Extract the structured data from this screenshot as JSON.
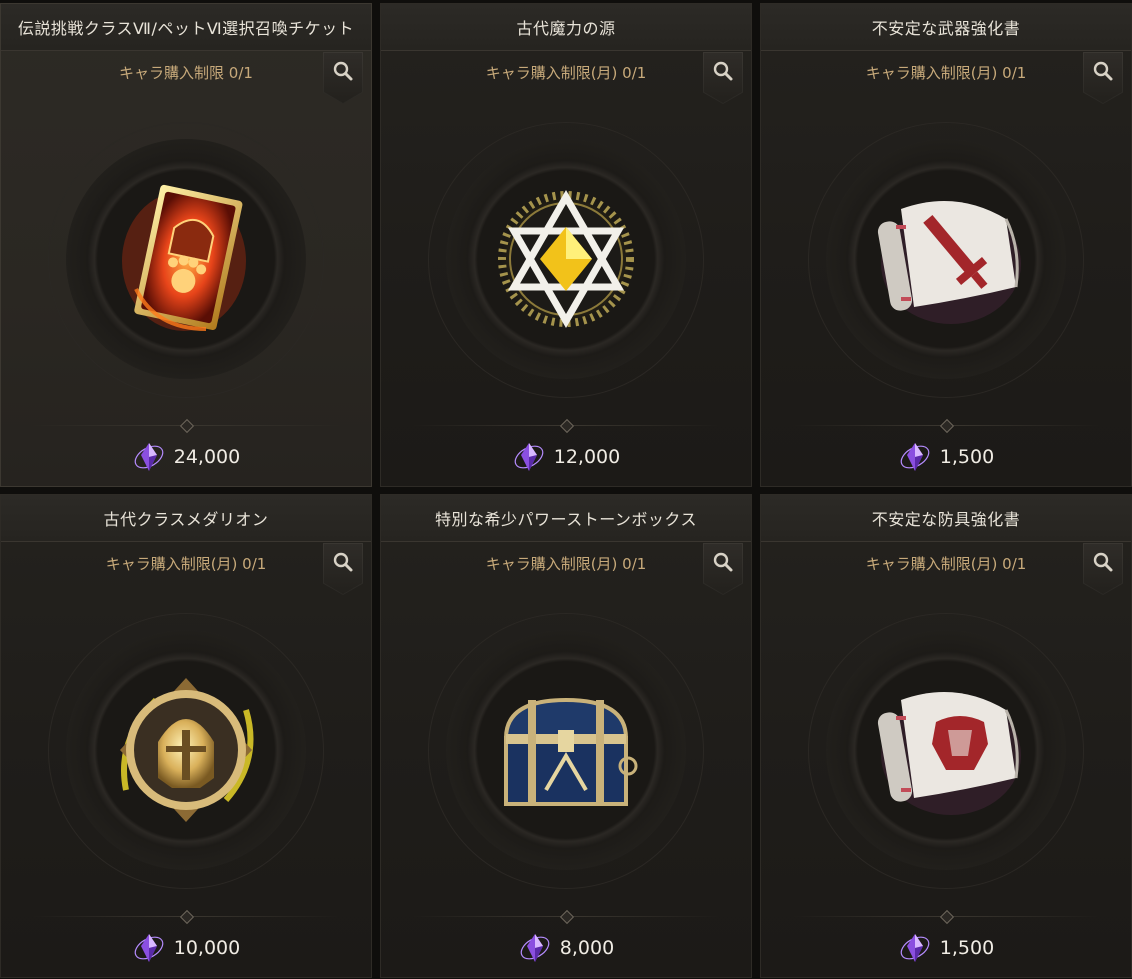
{
  "items": [
    {
      "title": "伝説挑戦クラスⅦ/ペットⅥ選択召喚チケット",
      "limit": "キャラ購入制限 0/1",
      "price": "24,000",
      "icon": "legendary-ticket-icon"
    },
    {
      "title": "古代魔力の源",
      "limit": "キャラ購入制限(月) 0/1",
      "price": "12,000",
      "icon": "ancient-magic-source-icon"
    },
    {
      "title": "不安定な武器強化書",
      "limit": "キャラ購入制限(月) 0/1",
      "price": "1,500",
      "icon": "weapon-scroll-icon"
    },
    {
      "title": "古代クラスメダリオン",
      "limit": "キャラ購入制限(月) 0/1",
      "price": "10,000",
      "icon": "class-medallion-icon"
    },
    {
      "title": "特別な希少パワーストーンボックス",
      "limit": "キャラ購入制限(月) 0/1",
      "price": "8,000",
      "icon": "treasure-chest-icon"
    },
    {
      "title": "不安定な防具強化書",
      "limit": "キャラ購入制限(月) 0/1",
      "price": "1,500",
      "icon": "armor-scroll-icon"
    }
  ],
  "currency_icon": "purple-crystal-icon",
  "colors": {
    "title": "#e8e3d8",
    "limit": "#c7a97a",
    "price": "#f0ece4",
    "background": "#1f1d1a"
  }
}
